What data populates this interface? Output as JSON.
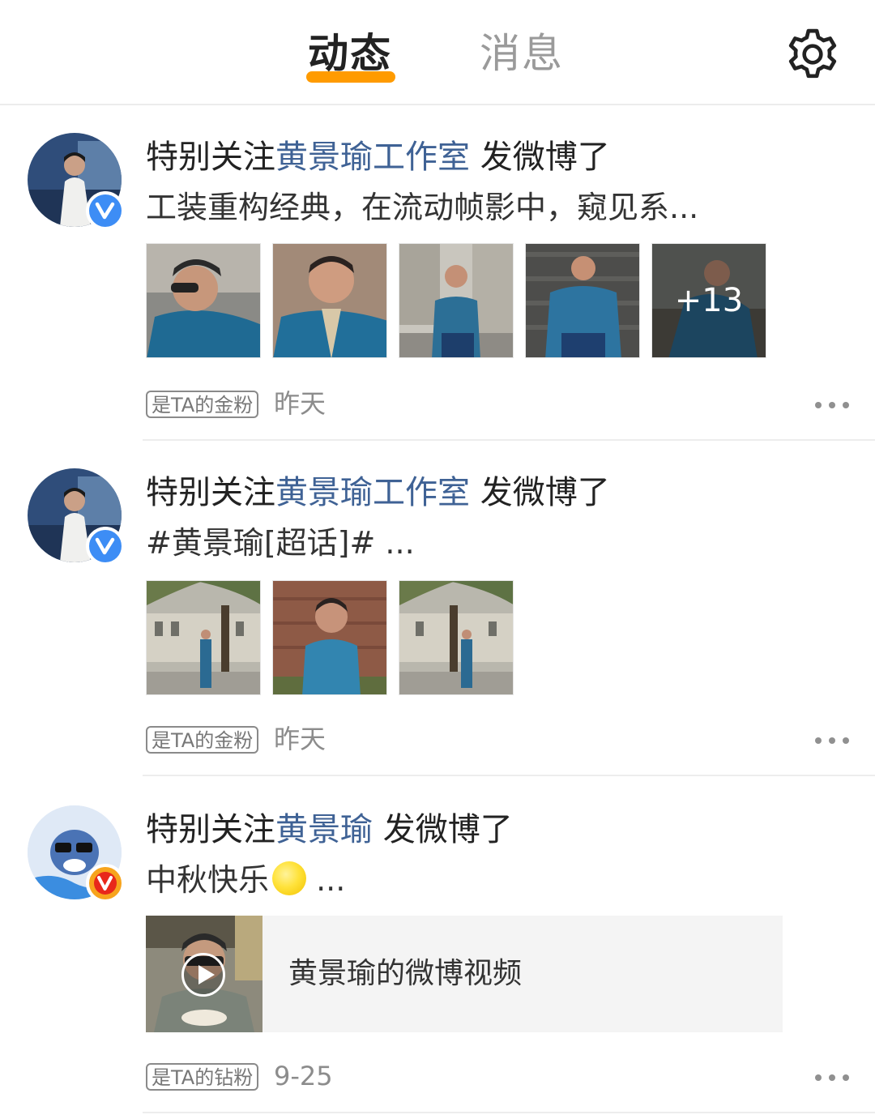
{
  "header": {
    "tabs": [
      {
        "label": "动态",
        "active": true
      },
      {
        "label": "消息",
        "active": false
      }
    ],
    "settings_icon": "gear-icon",
    "accent_color": "#ff9b00"
  },
  "posts": [
    {
      "prefix": "特别关注",
      "account": "黄景瑜工作室",
      "suffix": " 发微博了",
      "snippet": "工装重构经典，在流动帧影中，窥见系...",
      "verified_badge": "blue-v-badge-icon",
      "images": [
        {
          "name": "photo-1"
        },
        {
          "name": "photo-2"
        },
        {
          "name": "photo-3"
        },
        {
          "name": "photo-4"
        },
        {
          "name": "photo-5",
          "more_count": "+13"
        }
      ],
      "tag": "是TA的金粉",
      "time": "昨天"
    },
    {
      "prefix": "特别关注",
      "account": "黄景瑜工作室",
      "suffix": " 发微博了",
      "snippet": "#黄景瑜[超话]#  ...",
      "verified_badge": "blue-v-badge-icon",
      "images": [
        {
          "name": "photo-1"
        },
        {
          "name": "photo-2"
        },
        {
          "name": "photo-3"
        }
      ],
      "tag": "是TA的金粉",
      "time": "昨天"
    },
    {
      "prefix": "特别关注",
      "account": "黄景瑜",
      "suffix": " 发微博了",
      "snippet_text": "中秋快乐",
      "snippet_emoji": "moon-emoji",
      "snippet_tail": " ...",
      "verified_badge": "orange-v-badge-icon",
      "video": {
        "label": "黄景瑜的微博视频",
        "play_icon": "play-icon"
      },
      "tag": "是TA的钻粉",
      "time": "9-25"
    }
  ]
}
